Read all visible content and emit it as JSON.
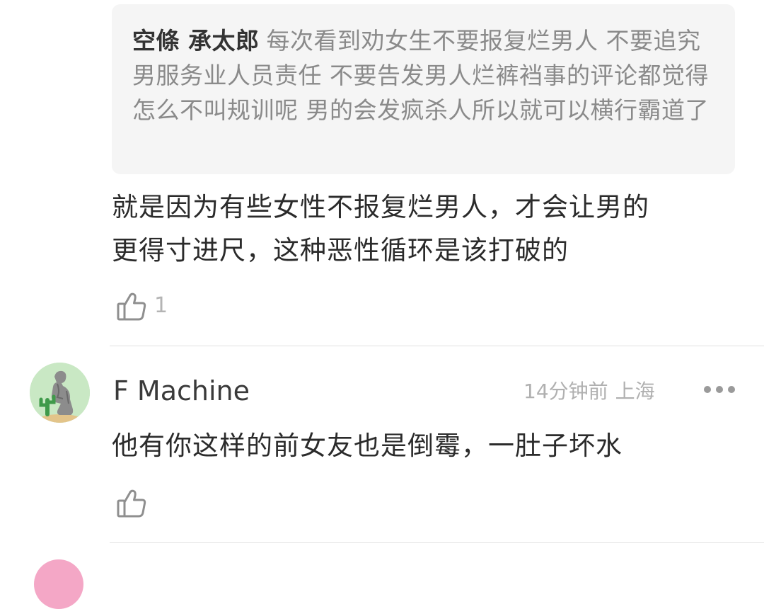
{
  "quoted_comment": {
    "author": "空條 承太郎",
    "text": "每次看到劝女生不要报复烂男人 不要追究男服务业人员责任 不要告发男人烂裤裆事的评论都觉得怎么不叫规训呢 男的会发疯杀人所以就可以横行霸道了"
  },
  "reply": {
    "text_line1": "就是因为有些女性不报复烂男人，才会让男的",
    "text_line2": "更得寸进尺，这种恶性循环是该打破的",
    "like_count": "1"
  },
  "comment": {
    "username": "F Machine",
    "time": "14分钟前",
    "location": "上海",
    "text": "他有你这样的前女友也是倒霉，一肚子坏水",
    "like_count": ""
  },
  "icons": {
    "like": "thumbs-up-icon",
    "more": "more-dots-icon"
  },
  "colors": {
    "quote_background": "#f5f5f5",
    "secondary_text": "#b0b0b0",
    "avatar_background": "#c9e8c4",
    "next_avatar": "#f4a7c6"
  }
}
